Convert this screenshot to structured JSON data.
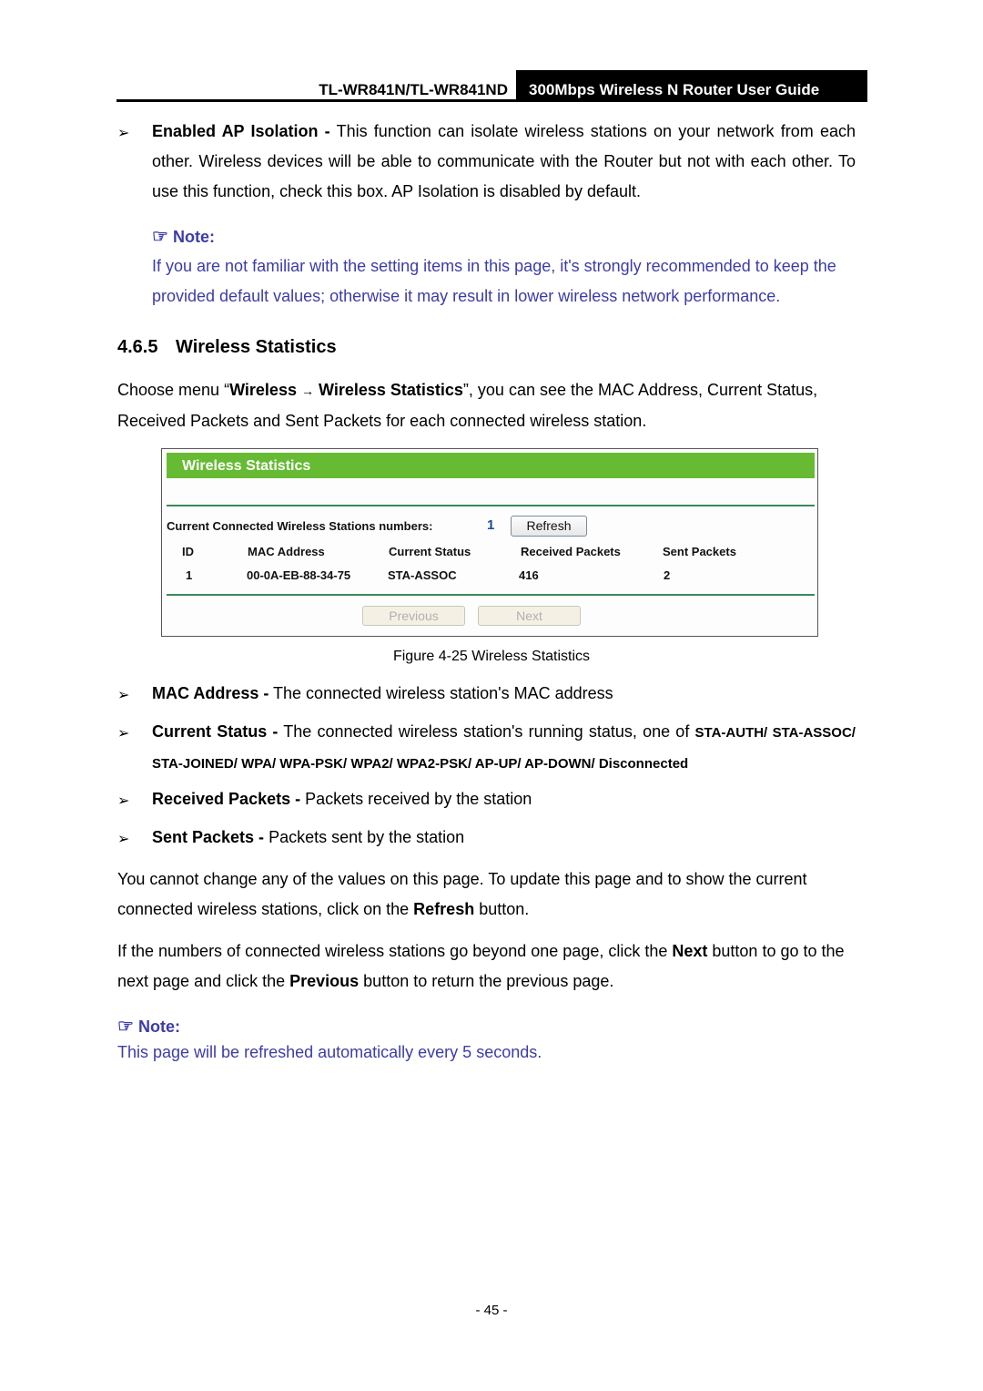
{
  "header": {
    "model": "TL-WR841N/TL-WR841ND",
    "guide_title": "300Mbps Wireless N Router User Guide"
  },
  "ap_isolation": {
    "term": "Enabled AP Isolation -",
    "text": " This function can isolate wireless stations on your network from each other. Wireless devices will be able to communicate with the Router but not with each other. To use this function, check this box. AP Isolation is disabled by default."
  },
  "note1": {
    "icon": "pointing-hand-icon",
    "label": "Note:",
    "text": "If you are not familiar with the setting items in this page, it's strongly recommended to keep the provided default values; otherwise it may result in lower wireless network performance."
  },
  "section": {
    "number": "4.6.5",
    "title": "Wireless Statistics"
  },
  "intro": {
    "prefix": "Choose menu “",
    "menu1": "Wireless",
    "arrow": "→",
    "menu2": "Wireless Statistics",
    "suffix": "”, you can see the MAC Address, Current Status, Received Packets and Sent Packets for each connected wireless station."
  },
  "figure": {
    "panel_title": "Wireless Statistics",
    "count_label": "Current Connected Wireless Stations numbers:",
    "count_value": "1",
    "refresh_label": "Refresh",
    "columns": [
      "ID",
      "MAC Address",
      "Current Status",
      "Received Packets",
      "Sent Packets"
    ],
    "rows": [
      [
        "1",
        "00-0A-EB-88-34-75",
        "STA-ASSOC",
        "416",
        "2"
      ]
    ],
    "previous_label": "Previous",
    "next_label": "Next",
    "caption": "Figure 4-25 Wireless Statistics",
    "colors": {
      "title_bar": "#66bb33",
      "divider": "#3a8a5a",
      "count_value": "#1a4aa0"
    }
  },
  "definitions": [
    {
      "term": "MAC Address -",
      "text": " The connected wireless station's MAC address"
    },
    {
      "term": "Current Status -",
      "text": " The connected wireless station's running status, one of ",
      "values": "STA-AUTH/ STA-ASSOC/ STA-JOINED/ WPA/ WPA-PSK/ WPA2/ WPA2-PSK/ AP-UP/ AP-DOWN/ Disconnected"
    },
    {
      "term": "Received Packets -",
      "text": " Packets received by the station"
    },
    {
      "term": "Sent Packets -",
      "text": " Packets sent by the station"
    }
  ],
  "para1": {
    "a": "You cannot change any of the values on this page. To update this page and to show the current connected wireless stations, click on the ",
    "b": "Refresh",
    "c": " button."
  },
  "para2": {
    "a": "If the numbers of connected wireless stations go beyond one page, click the ",
    "b": "Next",
    "c": " button to go to the next page and click the ",
    "d": "Previous",
    "e": " button to return the previous page."
  },
  "note2": {
    "icon": "pointing-hand-icon",
    "label": "Note:",
    "text": "This page will be refreshed automatically every 5 seconds."
  },
  "footer": {
    "page": "- 45 -"
  },
  "glyphs": {
    "bullet": "➢",
    "hand": "☞"
  }
}
